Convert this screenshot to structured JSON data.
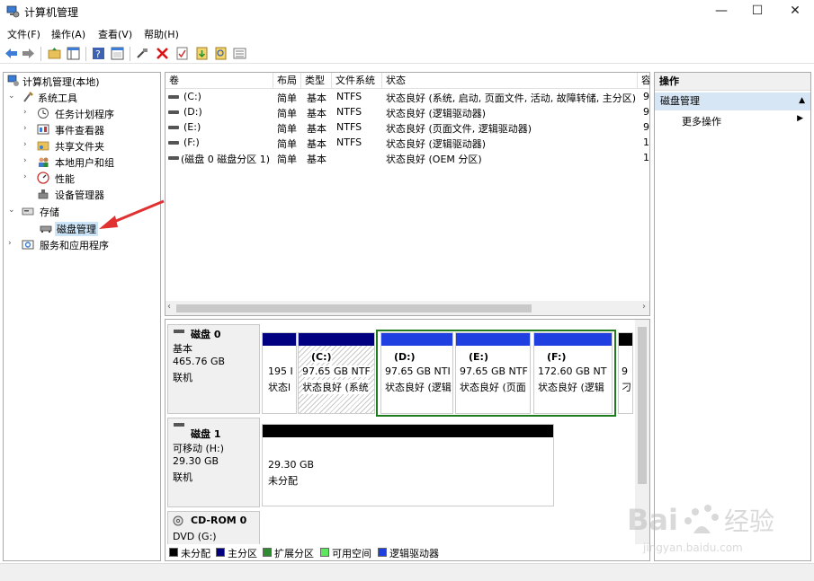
{
  "window": {
    "title": "计算机管理",
    "minimize": "—",
    "maximize": "☐",
    "close": "✕"
  },
  "menu": [
    "文件(F)",
    "操作(A)",
    "查看(V)",
    "帮助(H)"
  ],
  "toolbar_icons": [
    "back-icon",
    "forward-icon",
    "up-folder-icon",
    "show-hide-tree-icon",
    "help-icon",
    "properties-icon",
    "connect-icon",
    "delete-icon",
    "check-icon",
    "import-icon",
    "search-icon",
    "list-icon"
  ],
  "tree": {
    "root": "计算机管理(本地)",
    "system_tools": "系统工具",
    "task_scheduler": "任务计划程序",
    "event_viewer": "事件查看器",
    "shared_folders": "共享文件夹",
    "local_users": "本地用户和组",
    "performance": "性能",
    "device_manager": "设备管理器",
    "storage": "存储",
    "disk_management": "磁盘管理",
    "services_apps": "服务和应用程序"
  },
  "volume_list": {
    "columns": [
      "卷",
      "布局",
      "类型",
      "文件系统",
      "状态",
      "容"
    ],
    "rows": [
      {
        "vol": "(C:)",
        "layout": "简单",
        "type": "基本",
        "fs": "NTFS",
        "status": "状态良好 (系统, 启动, 页面文件, 活动, 故障转储, 主分区)",
        "cap": "9"
      },
      {
        "vol": "(D:)",
        "layout": "简单",
        "type": "基本",
        "fs": "NTFS",
        "status": "状态良好 (逻辑驱动器)",
        "cap": "9"
      },
      {
        "vol": "(E:)",
        "layout": "简单",
        "type": "基本",
        "fs": "NTFS",
        "status": "状态良好 (页面文件, 逻辑驱动器)",
        "cap": "9"
      },
      {
        "vol": "(F:)",
        "layout": "简单",
        "type": "基本",
        "fs": "NTFS",
        "status": "状态良好 (逻辑驱动器)",
        "cap": "1"
      },
      {
        "vol": "(磁盘 0 磁盘分区 1)",
        "layout": "简单",
        "type": "基本",
        "fs": "",
        "status": "状态良好 (OEM 分区)",
        "cap": "1"
      }
    ]
  },
  "disks": {
    "disk0": {
      "title": "磁盘 0",
      "kind": "基本",
      "size": "465.76 GB",
      "state": "联机",
      "p0": {
        "line1": "195 I",
        "line2": "状态l"
      },
      "c": {
        "name": "(C:)",
        "size": "97.65 GB NTF",
        "status": "状态良好 (系统"
      },
      "d": {
        "name": "(D:)",
        "size": "97.65 GB NTI",
        "status": "状态良好 (逻辑"
      },
      "e": {
        "name": "(E:)",
        "size": "97.65 GB NTF",
        "status": "状态良好 (页面"
      },
      "f": {
        "name": "(F:)",
        "size": "172.60 GB NT",
        "status": "状态良好 (逻辑"
      },
      "last": {
        "line1": "9",
        "line2": "刁"
      }
    },
    "disk1": {
      "title": "磁盘 1",
      "kind": "可移动 (H:)",
      "size": "29.30 GB",
      "state": "联机",
      "part": {
        "size": "29.30 GB",
        "status": "未分配"
      }
    },
    "cdrom": {
      "title": "CD-ROM 0",
      "kind": "DVD (G:)"
    }
  },
  "legend": [
    {
      "label": "未分配",
      "color": "#000000"
    },
    {
      "label": "主分区",
      "color": "#000080"
    },
    {
      "label": "扩展分区",
      "color": "#2e8b2e"
    },
    {
      "label": "可用空间",
      "color": "#5ee65e"
    },
    {
      "label": "逻辑驱动器",
      "color": "#1f3fe0"
    }
  ],
  "actions": {
    "header": "操作",
    "section": "磁盘管理",
    "more": "更多操作"
  },
  "watermark": {
    "brand": "Bai",
    "brand2": "经验",
    "url": "jingyan.baidu.com"
  }
}
